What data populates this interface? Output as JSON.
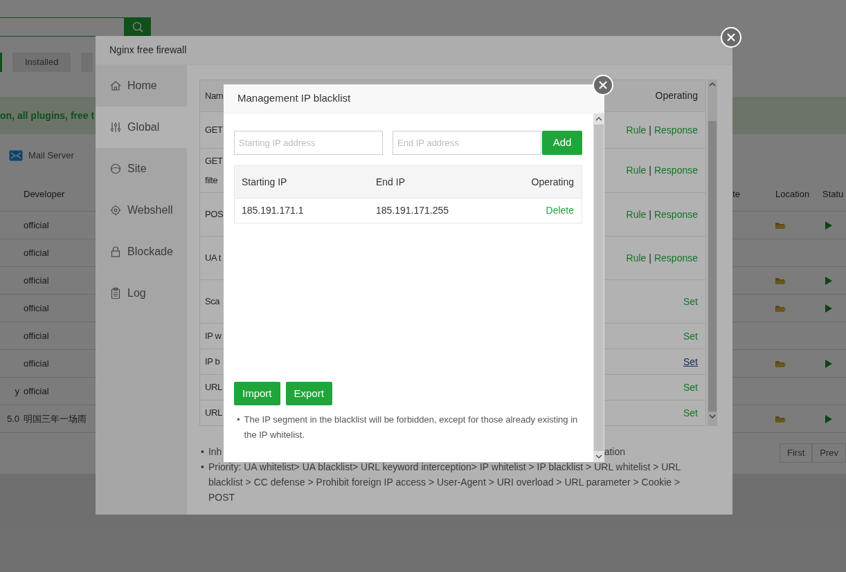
{
  "background_page": {
    "filter_buttons": [
      {
        "selected": true
      },
      {
        "label": "Installed",
        "selected": false
      },
      {
        "selected": false
      }
    ],
    "notice": "on, all plugins, free t",
    "app_links": [
      {
        "label": "Mail Server"
      }
    ],
    "table": {
      "columns": [
        "Developer",
        "te",
        "Location",
        "Statu"
      ],
      "rows": [
        {
          "developer": "official",
          "folder_icon": true,
          "play_icon": true
        },
        {
          "developer": "official",
          "folder_icon": false,
          "play_icon": false
        },
        {
          "developer": "official",
          "folder_icon": true,
          "play_icon": true
        },
        {
          "developer": "official",
          "folder_icon": true,
          "play_icon": true
        },
        {
          "developer": "official",
          "folder_icon": false,
          "play_icon": false
        },
        {
          "developer": "official",
          "folder_icon": true,
          "play_icon": true
        },
        {
          "column_1": "y",
          "developer": "official",
          "folder_icon": false,
          "play_icon": false
        },
        {
          "column_1": "5.0",
          "developer": "明国三年一场雨",
          "folder_icon": true,
          "play_icon": true
        }
      ]
    },
    "pagination": [
      {
        "label": "First"
      },
      {
        "label": "Prev"
      }
    ]
  },
  "firewall": {
    "title": "Nginx free firewall",
    "sidebar": [
      {
        "label": "Home",
        "selected": false
      },
      {
        "label": "Global",
        "selected": true
      },
      {
        "label": "Site",
        "selected": false
      },
      {
        "label": "Webshell",
        "selected": false
      },
      {
        "label": "Blockade",
        "selected": false
      },
      {
        "label": "Log",
        "selected": false
      }
    ],
    "rules_table": {
      "columns": [
        "Nam",
        "Operating"
      ],
      "rows": [
        {
          "name": [
            "GET"
          ],
          "actions": [
            "Rule",
            "Response"
          ],
          "separator": "|",
          "hovered": false
        },
        {
          "name": [
            "GET",
            "filte"
          ],
          "actions": [
            "Rule",
            "Response"
          ],
          "separator": "|",
          "hovered": false
        },
        {
          "name": [
            "POS"
          ],
          "actions": [
            "Rule",
            "Response"
          ],
          "separator": "|",
          "hovered": false
        },
        {
          "name": [
            "UA t"
          ],
          "actions": [
            "Rule",
            "Response"
          ],
          "separator": "|",
          "hovered": false
        },
        {
          "name": [
            "Sca"
          ],
          "actions": [
            "Set"
          ],
          "hovered": false
        },
        {
          "name": [
            "IP w"
          ],
          "actions": [
            "Set"
          ],
          "hovered": false
        },
        {
          "name": [
            "IP b"
          ],
          "actions": [
            "Set"
          ],
          "hovered": true
        },
        {
          "name": [
            "URL"
          ],
          "actions": [
            "Set"
          ],
          "hovered": false
        },
        {
          "name": [
            "URL"
          ],
          "actions": [
            "Set"
          ],
          "hovered": false
        }
      ]
    },
    "notes": [
      {
        "bullet": "•",
        "visible_start": "Inh",
        "visible_end": "ation"
      },
      {
        "bullet": "•",
        "text": "Priority: UA whitelist> UA blacklist> URL keyword interception> IP whitelist > IP blacklist > URL whitelist > URL blacklist > CC defense > Prohibit foreign IP access > User-Agent > URI overload > URL parameter > Cookie > POST"
      }
    ]
  },
  "blacklist_dialog": {
    "title": "Management IP blacklist",
    "start_field": {
      "placeholder": "Starting IP address"
    },
    "end_field": {
      "placeholder": "End IP address"
    },
    "add_button": "Add",
    "table": {
      "columns": [
        "Starting IP",
        "End IP",
        "Operating"
      ],
      "rows": [
        {
          "start": "185.191.171.1",
          "end": "185.191.171.255",
          "action": "Delete"
        }
      ]
    },
    "buttons": [
      "Import",
      "Export"
    ],
    "note_bullet": "•",
    "note": "The IP segment in the blacklist will be forbidden, except for those already existing in the IP whitelist."
  }
}
